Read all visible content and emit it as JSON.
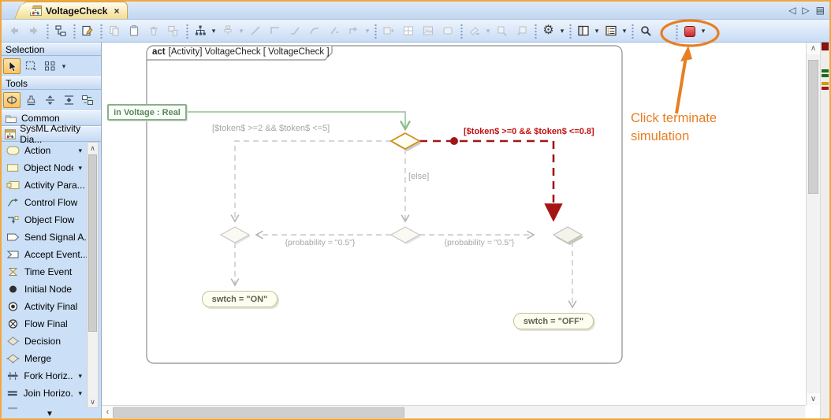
{
  "icons": {
    "dropdown": "▾",
    "close": "×",
    "tab_prev": "◁",
    "tab_next": "▷",
    "tab_list": "▤",
    "scroll_up": "∧",
    "scroll_down": "∨",
    "scroll_left": "‹",
    "scroll_right": "›",
    "palette_more": "▼",
    "gear": "⚙"
  },
  "tab": {
    "label": "VoltageCheck"
  },
  "toolbar": {
    "buttons": [
      "back",
      "forward",
      "containment-tree",
      "diagram-properties",
      "copy",
      "paste",
      "delete",
      "delete-from-diagram",
      "layout-tree",
      "align",
      "draw-diagonal-line",
      "draw-rectilinear-line",
      "draw-oblique-line",
      "draw-curved-line",
      "draw-mixed-line",
      "reroute-path",
      "make-same-size",
      "show-grid",
      "insert-image",
      "show-shape",
      "format-painter",
      "copy-format",
      "paste-format",
      "diagram-options",
      "show-windows",
      "show-list",
      "search",
      "terminate-simulation"
    ]
  },
  "palette": {
    "sections": {
      "selection": "Selection",
      "tools": "Tools"
    },
    "folders": {
      "common": "Common",
      "sysml": "SysML Activity Dia..."
    },
    "items": [
      {
        "label": "Action",
        "icon": "action-icon",
        "dropdown": true
      },
      {
        "label": "Object Node",
        "icon": "object-node-icon",
        "dropdown": true
      },
      {
        "label": "Activity Para...",
        "icon": "activity-parameter-icon"
      },
      {
        "label": "Control Flow",
        "icon": "control-flow-icon"
      },
      {
        "label": "Object Flow",
        "icon": "object-flow-icon"
      },
      {
        "label": "Send Signal A...",
        "icon": "send-signal-icon"
      },
      {
        "label": "Accept Event...",
        "icon": "accept-event-icon"
      },
      {
        "label": "Time Event",
        "icon": "time-event-icon"
      },
      {
        "label": "Initial Node",
        "icon": "initial-node-icon"
      },
      {
        "label": "Activity Final",
        "icon": "activity-final-icon"
      },
      {
        "label": "Flow Final",
        "icon": "flow-final-icon"
      },
      {
        "label": "Decision",
        "icon": "decision-icon"
      },
      {
        "label": "Merge",
        "icon": "merge-icon"
      },
      {
        "label": "Fork Horiz...",
        "icon": "fork-horizontal-icon",
        "dropdown": true
      },
      {
        "label": "Join Horizo...",
        "icon": "join-horizontal-icon",
        "dropdown": true
      }
    ]
  },
  "diagram": {
    "frame_keyword": "act",
    "frame_title": "[Activity] VoltageCheck [ VoltageCheck ]",
    "parameter": "in Voltage : Real",
    "guard_left": "[$token$ >=2 && $token$ <=5]",
    "guard_right": "[$token$ >=0 && $token$ <=0.8]",
    "guard_else": "[else]",
    "prob_left": "{probability = \"0.5\"}",
    "prob_right": "{probability = \"0.5\"}",
    "action_on": "swtch = \"ON\"",
    "action_off": "swtch = \"OFF\""
  },
  "annotation": {
    "line1": "Click terminate",
    "line2": "simulation",
    "color": "#e87e22"
  },
  "colors": {
    "window_border": "#f2a73d",
    "highlight_gold": "#cf9018",
    "flow_red": "#a01616",
    "flow_green": "#93c193",
    "annotation_orange": "#e87e22"
  }
}
